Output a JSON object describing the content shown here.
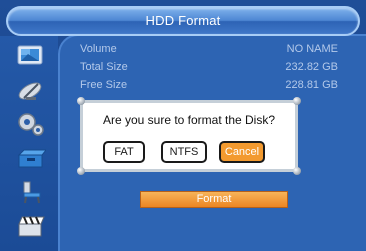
{
  "window": {
    "title": "HDD Format"
  },
  "info": {
    "volume_label": "Volume",
    "volume_value": "NO NAME",
    "total_label": "Total Size",
    "total_value": "232.82 GB",
    "free_label": "Free Size",
    "free_value": "228.81 GB"
  },
  "dialog": {
    "message": "Are you sure to format the Disk?",
    "buttons": [
      "FAT",
      "NTFS",
      "Cancel"
    ],
    "selected": "Cancel"
  },
  "format_button": {
    "label": "Format"
  },
  "sidebar": {
    "icons": [
      "desktop-window-icon",
      "satellite-dish-icon",
      "gears-icon",
      "toolbox-icon",
      "chair-icon",
      "clapperboard-icon"
    ]
  },
  "colors": {
    "background": "#1f4e98",
    "panel": "#2d64b3",
    "accent": "#f39a2f",
    "title_bar": "#4d86d3"
  }
}
